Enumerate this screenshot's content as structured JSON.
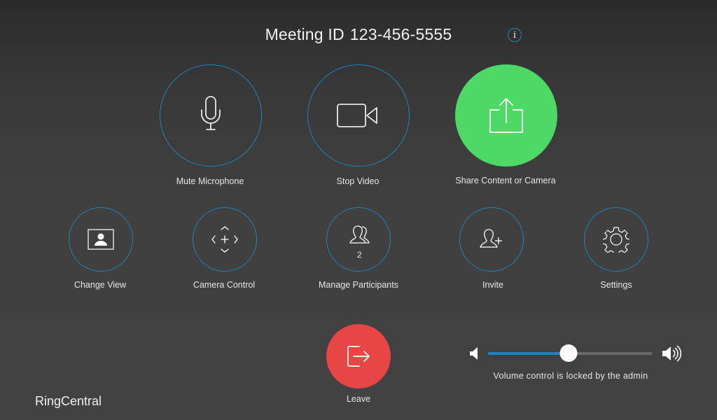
{
  "header": {
    "meeting_id_label": "Meeting ID",
    "meeting_id": "123-456-5555",
    "info_icon_glyph": "i"
  },
  "primary_actions": [
    {
      "id": "mute-microphone",
      "label": "Mute Microphone",
      "icon": "microphone-icon"
    },
    {
      "id": "stop-video",
      "label": "Stop Video",
      "icon": "video-camera-icon"
    },
    {
      "id": "share-content",
      "label": "Share Content or Camera",
      "icon": "share-icon"
    }
  ],
  "secondary_actions": [
    {
      "id": "change-view",
      "label": "Change View",
      "icon": "person-frame-icon"
    },
    {
      "id": "camera-control",
      "label": "Camera Control",
      "icon": "directional-pad-icon"
    },
    {
      "id": "manage-participants",
      "label": "Manage Participants",
      "icon": "participants-icon",
      "count": "2"
    },
    {
      "id": "invite",
      "label": "Invite",
      "icon": "add-person-icon"
    },
    {
      "id": "settings",
      "label": "Settings",
      "icon": "gear-icon"
    }
  ],
  "leave": {
    "label": "Leave",
    "icon": "exit-icon"
  },
  "volume": {
    "level_percent": 49,
    "locked_message": "Volume control is locked by the admin",
    "min_icon": "speaker-low-icon",
    "max_icon": "speaker-high-icon"
  },
  "brand": "RingCentral",
  "colors": {
    "accent_blue": "#1a86bd",
    "share_green": "#4cd964",
    "leave_red": "#e84545"
  }
}
